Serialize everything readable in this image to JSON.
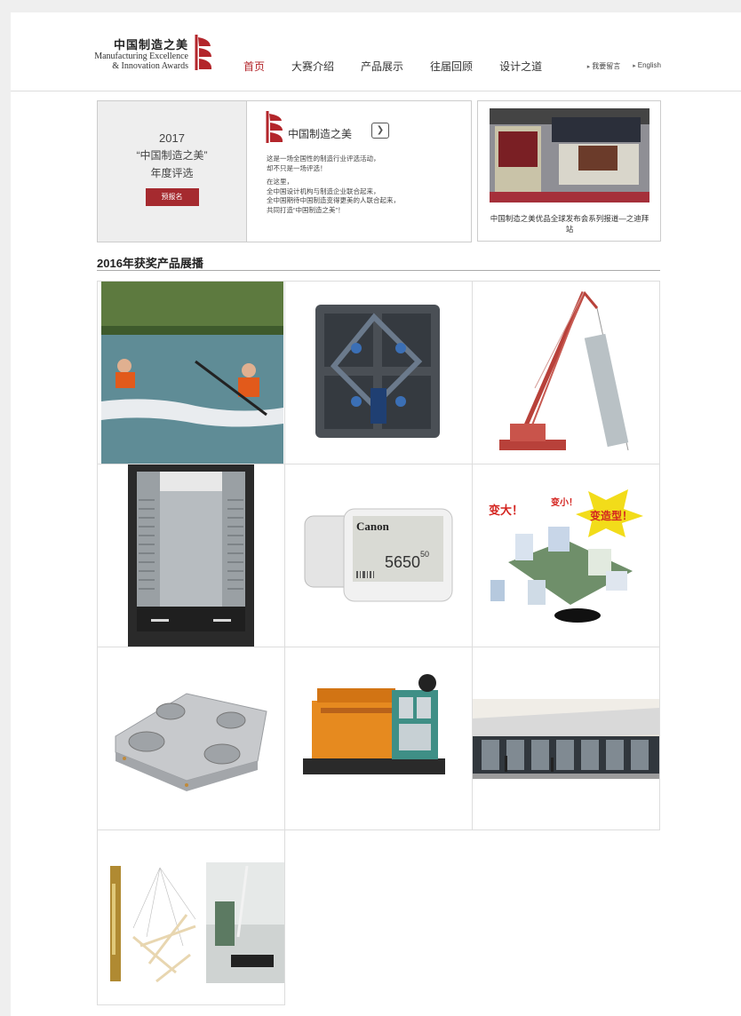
{
  "header": {
    "logo": {
      "zh": "中国制造之美",
      "en_line1": "Manufacturing Excellence",
      "en_line2": "& Innovation Awards"
    },
    "nav": [
      {
        "label": "首页",
        "active": true
      },
      {
        "label": "大赛介绍",
        "active": false
      },
      {
        "label": "产品展示",
        "active": false
      },
      {
        "label": "往届回顾",
        "active": false
      },
      {
        "label": "设计之道",
        "active": false
      }
    ],
    "util": {
      "guestbook": "我要留言",
      "english": "English"
    }
  },
  "promo": {
    "year": "2017",
    "title": "“中国制造之美”",
    "subtitle": "年度评选",
    "button": "预报名",
    "brand_name": "中国制造之美",
    "paragraph1": [
      "这是一场全国性的制造行业评选活动，",
      "却不只是一场评选！"
    ],
    "paragraph2": [
      "在这里，",
      "全中国设计机构与制造企业联合起来，",
      "全中国期待中国制造变得更美的人联合起来，",
      "共同打造“中国制造之美”！"
    ]
  },
  "news": {
    "caption": "中国制造之美优品全球发布会系列报道—之迪拜站"
  },
  "showcase": {
    "title": "2016年获奖产品展播",
    "items": [
      {
        "name": "kayak"
      },
      {
        "name": "led-display-panel"
      },
      {
        "name": "crawler-crane"
      },
      {
        "name": "elevator-cabin"
      },
      {
        "name": "electronic-shelf-label",
        "brand": "Canon",
        "price": "5650",
        "cents": "50"
      },
      {
        "name": "modular-exhibition-booth",
        "tag1": "变大！",
        "tag2": "变小！",
        "tag3": "变造型！"
      },
      {
        "name": "zero-point-clamping-plate"
      },
      {
        "name": "diesel-generator"
      },
      {
        "name": "showroom-building"
      },
      {
        "name": "pendant-lamp"
      }
    ]
  },
  "colors": {
    "brand_red": "#b3262b",
    "button_red": "#a52a2f"
  }
}
